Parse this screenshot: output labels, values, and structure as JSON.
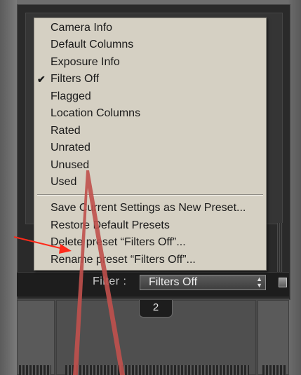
{
  "menu": {
    "items": [
      {
        "label": "Camera Info",
        "checked": false
      },
      {
        "label": "Default Columns",
        "checked": false
      },
      {
        "label": "Exposure Info",
        "checked": false
      },
      {
        "label": "Filters Off",
        "checked": true,
        "check_glyph": "✔"
      },
      {
        "label": "Flagged",
        "checked": false
      },
      {
        "label": "Location Columns",
        "checked": false
      },
      {
        "label": "Rated",
        "checked": false
      },
      {
        "label": "Unrated",
        "checked": false
      },
      {
        "label": "Unused",
        "checked": false
      },
      {
        "label": "Used",
        "checked": false
      }
    ],
    "actions": [
      {
        "label": "Save Current Settings as New Preset..."
      },
      {
        "label": "Restore Default Presets"
      },
      {
        "label": "Delete preset “Filters Off”..."
      },
      {
        "label": "Rename preset “Filters Off”..."
      }
    ]
  },
  "filter_bar": {
    "label": "Filter :",
    "selected": "Filters Off",
    "arrows_icon": "up-down-arrows-icon"
  },
  "filmstrip": {
    "page_number": "2"
  },
  "annotations": {
    "arrow_color": "#ff2a1a",
    "lines_color": "#c0504d"
  },
  "colors": {
    "menu_bg": "#d5d0c3",
    "panel_bg": "#2a2a2a"
  }
}
